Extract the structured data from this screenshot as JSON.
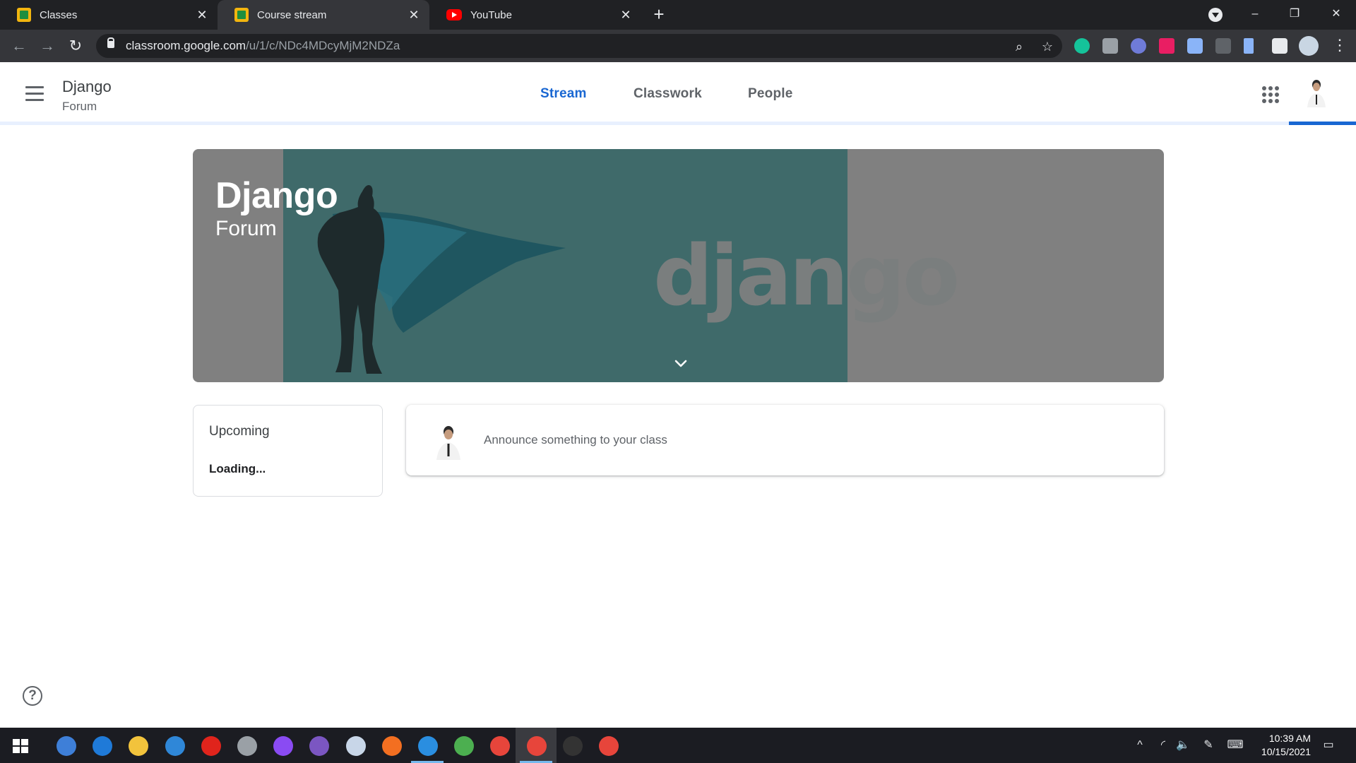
{
  "browser": {
    "tabs": [
      {
        "title": "Classes",
        "favicon": "classroom-icon",
        "active": false
      },
      {
        "title": "Course stream",
        "favicon": "classroom-icon",
        "active": true
      },
      {
        "title": "YouTube",
        "favicon": "youtube-icon",
        "active": false
      }
    ],
    "new_tab_label": "+",
    "url_host": "classroom.google.com",
    "url_path": "/u/1/c/NDc4MDcyMjM2NDZa",
    "window_controls": {
      "minimize": "–",
      "restore": "❐",
      "close": "✕"
    }
  },
  "classroom": {
    "class_name": "Django",
    "section": "Forum",
    "nav_tabs": [
      {
        "label": "Stream",
        "active": true
      },
      {
        "label": "Classwork",
        "active": false
      },
      {
        "label": "People",
        "active": false
      }
    ],
    "accent_color": "#1967d2"
  },
  "banner": {
    "title": "Django",
    "subtitle": "Forum",
    "art_text": "django",
    "art_color": "#3f6a6a",
    "background_color": "#808080"
  },
  "upcoming": {
    "title": "Upcoming",
    "status": "Loading..."
  },
  "announce": {
    "placeholder": "Announce something to your class"
  },
  "help": {
    "icon": "help-icon",
    "glyph": "?"
  },
  "taskbar": {
    "time": "10:39 AM",
    "date": "10/15/2021",
    "apps": [
      {
        "name": "qb",
        "color": "#3e7fd8"
      },
      {
        "name": "edge",
        "color": "#1f7ad8"
      },
      {
        "name": "file-explorer",
        "color": "#f2c33c"
      },
      {
        "name": "mail",
        "color": "#2f87d8"
      },
      {
        "name": "opera",
        "color": "#e0241c"
      },
      {
        "name": "satellite",
        "color": "#9aa0a6"
      },
      {
        "name": "messenger",
        "color": "#8a4bf3"
      },
      {
        "name": "github",
        "color": "#7b56c2"
      },
      {
        "name": "paint",
        "color": "#c8d6e8"
      },
      {
        "name": "firefox",
        "color": "#f36f21"
      },
      {
        "name": "vscode",
        "color": "#2a8ee0"
      },
      {
        "name": "earth",
        "color": "#4caf50"
      },
      {
        "name": "chrome",
        "color": "#e7453b"
      },
      {
        "name": "chrome-active",
        "color": "#e7453b"
      },
      {
        "name": "terminal",
        "color": "#333333"
      },
      {
        "name": "chrome-ek",
        "color": "#e7453b"
      }
    ]
  }
}
